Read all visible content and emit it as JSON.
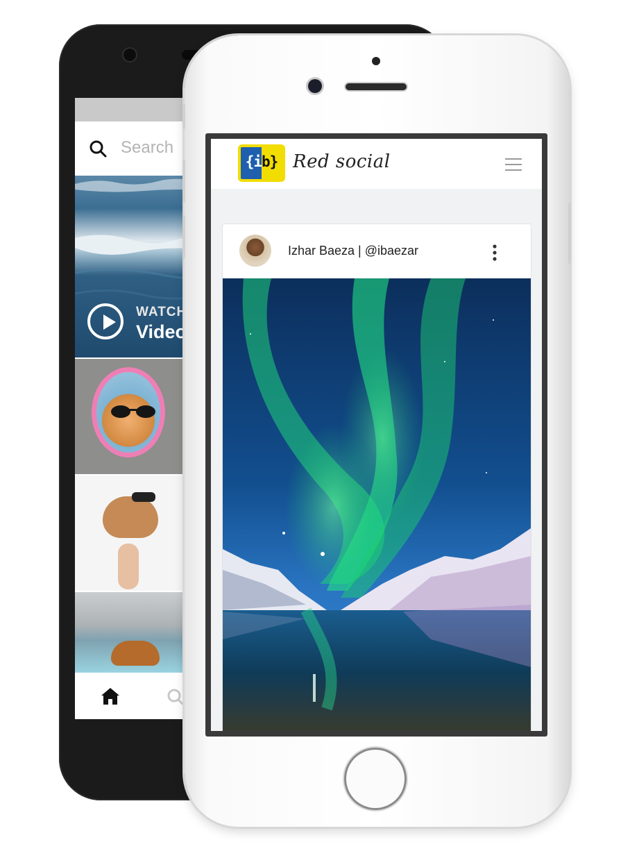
{
  "back_phone": {
    "search": {
      "placeholder": "Search"
    },
    "video_tile": {
      "watch_label": "WATCH",
      "video_label": "Video"
    },
    "nav": {
      "home_icon": "home-icon",
      "search_icon": "search-icon"
    }
  },
  "front_phone": {
    "app": {
      "brand": "Red social",
      "logo_text_left": "{i",
      "logo_text_right": "b}",
      "logo_colors": {
        "blue": "#1e5fb0",
        "yellow": "#f2dd00"
      },
      "menu_icon": "hamburger-menu-icon"
    },
    "post": {
      "author": "Izhar Baeza | @ibaezar",
      "options_icon": "more-vertical-icon",
      "image_subject": "aurora-over-mountain-lake"
    }
  }
}
